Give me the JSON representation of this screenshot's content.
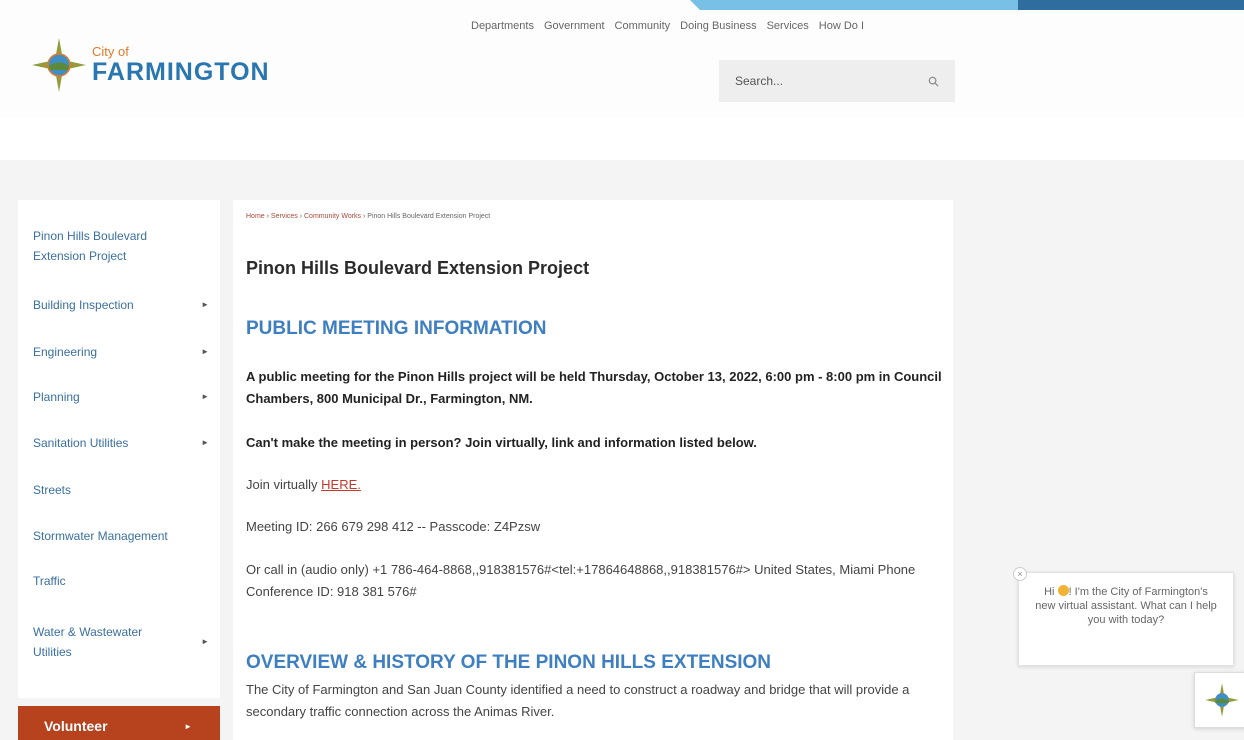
{
  "logo": {
    "city_of": "City of",
    "name": "FARMINGTON"
  },
  "topnav": [
    "Departments",
    "Government",
    "Community",
    "Doing Business",
    "Services",
    "How Do I"
  ],
  "search": {
    "placeholder": "Search..."
  },
  "sidebar": {
    "items": [
      {
        "label": "Pinon Hills Boulevard Extension Project",
        "has_submenu": false
      },
      {
        "label": "Building Inspection",
        "has_submenu": true
      },
      {
        "label": "Engineering",
        "has_submenu": true
      },
      {
        "label": "Planning",
        "has_submenu": true
      },
      {
        "label": "Sanitation Utilities",
        "has_submenu": true
      },
      {
        "label": "Streets",
        "has_submenu": false
      },
      {
        "label": "Stormwater Management",
        "has_submenu": false
      },
      {
        "label": "Traffic",
        "has_submenu": false
      },
      {
        "label": "Water & Wastewater Utilities",
        "has_submenu": true
      }
    ],
    "volunteer_label": "Volunteer"
  },
  "breadcrumb": [
    "Home",
    "Services",
    "Community Works",
    "Pinon Hills Boulevard Extension Project"
  ],
  "page_title": "Pinon Hills Boulevard Extension Project",
  "sections": {
    "meeting_heading": "PUBLIC MEETING INFORMATION",
    "meeting_notice": "A public meeting for the Pinon Hills project will be held Thursday, October 13, 2022, 6:00 pm - 8:00 pm in Council Chambers, 800 Municipal Dr., Farmington, NM.",
    "cant_make_it": "Can't make the meeting in person? Join virtually, link and information listed below.",
    "join_text": "Join virtually ",
    "join_link": "HERE.",
    "meeting_id": "Meeting ID: 266 679 298 412  -- Passcode: Z4Pzsw",
    "call_in": "Or call in (audio only) +1 786-464-8868,,918381576#<tel:+17864648868,,918381576#> United States, Miami Phone Conference ID: 918 381 576#",
    "overview_heading": "OVERVIEW & HISTORY OF THE PINON HILLS EXTENSION",
    "overview_text": "The City of Farmington and San Juan County identified a need to construct a roadway and bridge that will provide a secondary traffic connection across the Animas River."
  },
  "chat": {
    "greeting_pre": "Hi ",
    "greeting_post": "! I'm the City of Farmington's new virtual assistant. What can I help you with today?",
    "close_symbol": "×"
  },
  "colors": {
    "brand_blue": "#2a76b0",
    "accent_orange": "#e07a2b",
    "volunteer_red": "#b6421e",
    "heading_blue": "#3e7fc1"
  }
}
